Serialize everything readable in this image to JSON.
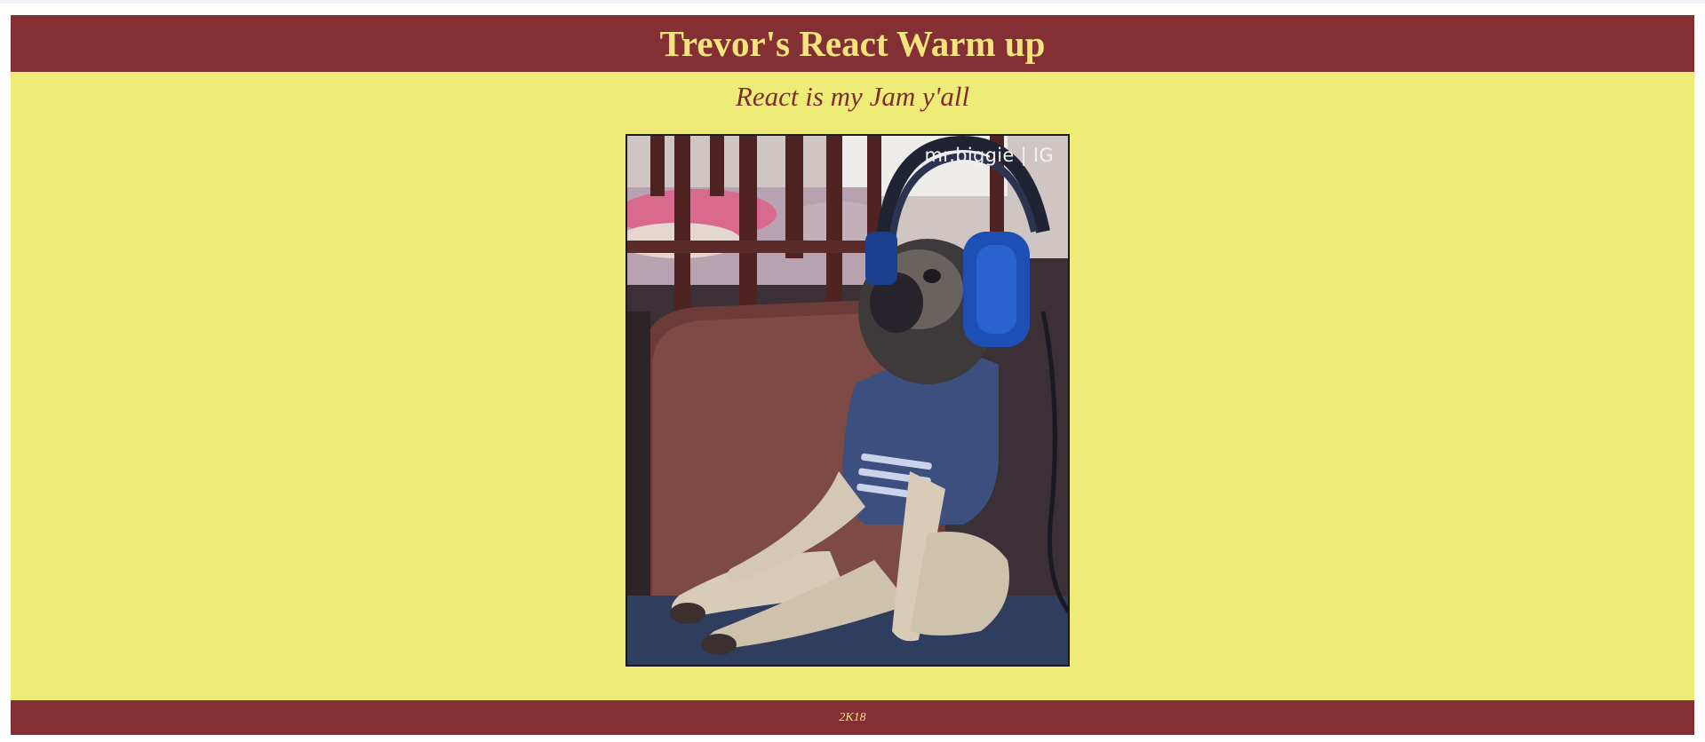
{
  "header": {
    "title": "Trevor's React Warm up"
  },
  "main": {
    "subtitle": "React is my Jam y'all",
    "image": {
      "subject": "pug-with-headphones-gif",
      "watermark": "mr.biggie | IG"
    }
  },
  "footer": {
    "text": "2K18"
  },
  "colors": {
    "header_bg": "#842f33",
    "header_text": "#f3e47e",
    "page_bg": "#eeeb77",
    "subtitle_text": "#7d2d33"
  }
}
